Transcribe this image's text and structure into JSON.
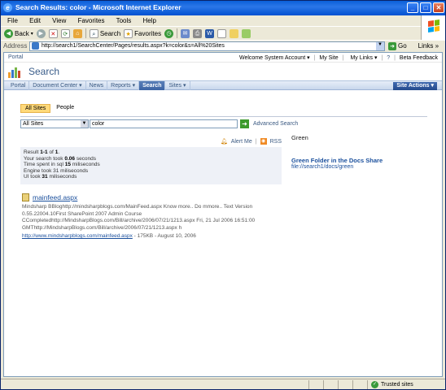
{
  "window": {
    "title": "Search Results: color - Microsoft Internet Explorer",
    "buttons": {
      "minimize": "_",
      "maximize": "□",
      "close": "✕"
    }
  },
  "menu": [
    "File",
    "Edit",
    "View",
    "Favorites",
    "Tools",
    "Help"
  ],
  "toolbar": {
    "back": "Back",
    "search": "Search",
    "favorites": "Favorites"
  },
  "address": {
    "label": "Address",
    "url": "http://search1/SearchCenter/Pages/results.aspx?k=color&s=All%20Sites",
    "go": "Go",
    "links": "Links"
  },
  "portal": {
    "breadcrumb": "Portal",
    "welcome": "Welcome System Account",
    "mysite": "My Site",
    "mylinks": "My Links",
    "beta": "Beta Feedback"
  },
  "header": {
    "title": "Search"
  },
  "nav": {
    "tabs": [
      "Portal",
      "Document Center",
      "News",
      "Reports",
      "Search",
      "Sites"
    ],
    "active_index": 4,
    "site_actions": "Site Actions"
  },
  "search": {
    "scope_tabs": [
      "All Sites",
      "People"
    ],
    "scope_value": "All Sites",
    "query": "color",
    "advanced": "Advanced Search"
  },
  "results": {
    "alert": "Alert Me",
    "rss": "RSS",
    "stats": {
      "line1_prefix": "Result ",
      "line1_range": "1-1",
      "line1_mid": " of ",
      "line1_total": "1",
      "line1_suffix": ".",
      "line2_prefix": "Your search took ",
      "line2_val": "0.06",
      "line2_suffix": " seconds",
      "line3_prefix": "Time spent in sql ",
      "line3_val": "15",
      "line3_suffix": " miliseconds",
      "line4": "Engine took 31 miliseconds",
      "line5_prefix": "UI took ",
      "line5_val": "31",
      "line5_suffix": " miliseconds"
    },
    "items": [
      {
        "title": "mainfeed.aspx",
        "snippet": "Mindsharp BBloghttp://mindsharpblogs.com/MainFeed.aspx Know more.. Do mmore.. Text Version 0.55.22004.10First SharePoint 2007 Admin Course CCompletedhttp://MindsharpBlogs.com/Bill/archive/2006/07/21/1213.aspx Fri, 21 Jul 2006 16:51:00 GMThttp://MindsharpBlogs.com/Bill/archive/2006/07/21/1213.aspx h",
        "url": "http://www.mindsharpblogs.com/mainfeed.aspx",
        "meta": " - 175KB - August 10, 2006"
      }
    ]
  },
  "best_bets": {
    "heading": "Green",
    "title": "Green Folder in the Docs Share",
    "path": "file://search1/docs/green"
  },
  "status": {
    "zone": "Trusted sites"
  }
}
